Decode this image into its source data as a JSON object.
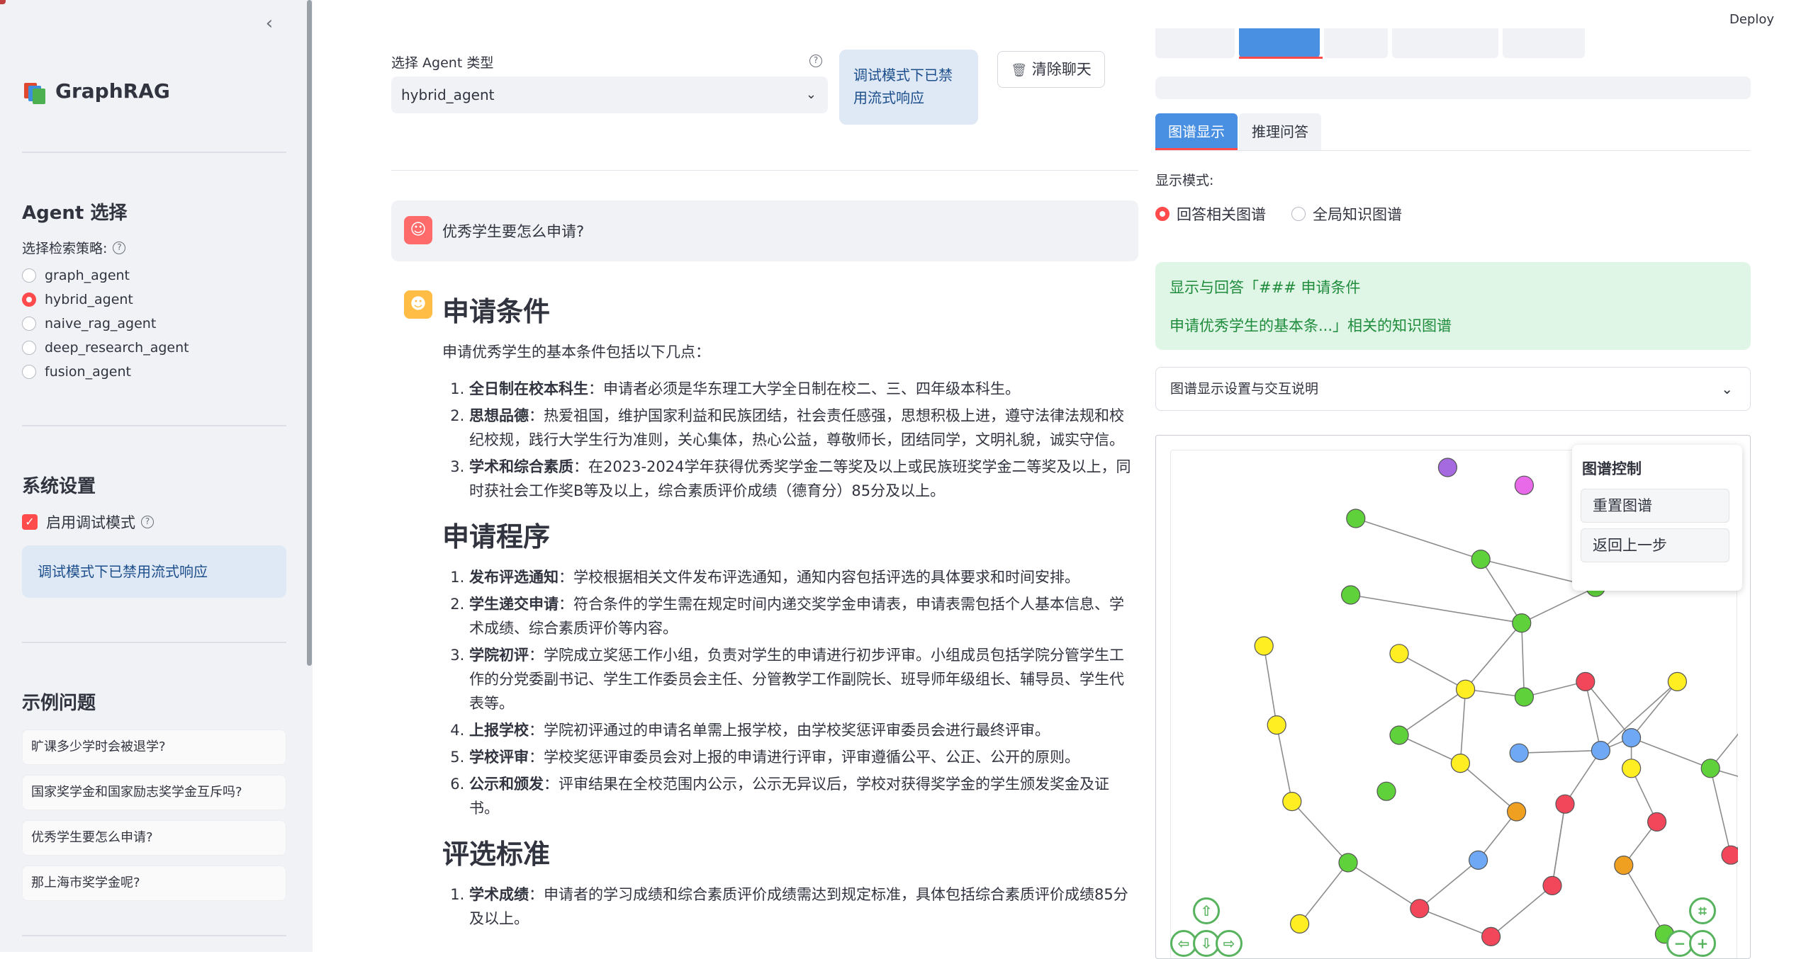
{
  "app": {
    "brand": "GraphRAG",
    "deploy": "Deploy"
  },
  "sidebar": {
    "collapse_icon": "chevron-left-icon",
    "agent_section_title": "Agent 选择",
    "strategy_label": "选择检索策略:",
    "agents": [
      "graph_agent",
      "hybrid_agent",
      "naive_rag_agent",
      "deep_research_agent",
      "fusion_agent"
    ],
    "selected_agent": "hybrid_agent",
    "system_title": "系统设置",
    "debug_label": "启用调试模式",
    "debug_checked": true,
    "debug_info": "调试模式下已禁用流式响应",
    "examples_title": "示例问题",
    "examples": [
      "旷课多少学时会被退学?",
      "国家奖学金和国家励志奖学金互斥吗?",
      "优秀学生要怎么申请?",
      "那上海市奖学金呢?"
    ]
  },
  "main": {
    "select_label": "选择 Agent 类型",
    "select_value": "hybrid_agent",
    "debug_notice": "调试模式下已禁用流式响应",
    "clear_button": "清除聊天",
    "user_message": "优秀学生要怎么申请?",
    "answer": {
      "h1": "申请条件",
      "intro": "申请优秀学生的基本条件包括以下几点：",
      "conditions": [
        {
          "b": "全日制在校本科生",
          "t": "：申请者必须是华东理工大学全日制在校二、三、四年级本科生。"
        },
        {
          "b": "思想品德",
          "t": "：热爱祖国，维护国家利益和民族团结，社会责任感强，思想积极上进，遵守法律法规和校纪校规，践行大学生行为准则，关心集体，热心公益，尊敬师长，团结同学，文明礼貌，诚实守信。"
        },
        {
          "b": "学术和综合素质",
          "t": "：在2023-2024学年获得优秀奖学金二等奖及以上或民族班奖学金二等奖及以上，同时获社会工作奖B等及以上，综合素质评价成绩（德育分）85分及以上。"
        }
      ],
      "h2": "申请程序",
      "procedures": [
        {
          "b": "发布评选通知",
          "t": "：学校根据相关文件发布评选通知，通知内容包括评选的具体要求和时间安排。"
        },
        {
          "b": "学生递交申请",
          "t": "：符合条件的学生需在规定时间内递交奖学金申请表，申请表需包括个人基本信息、学术成绩、综合素质评价等内容。"
        },
        {
          "b": "学院初评",
          "t": "：学院成立奖惩工作小组，负责对学生的申请进行初步评审。小组成员包括学院分管学生工作的分党委副书记、学生工作委员会主任、分管教学工作副院长、班导师年级组长、辅导员、学生代表等。"
        },
        {
          "b": "上报学校",
          "t": "：学院初评通过的申请名单需上报学校，由学校奖惩评审委员会进行最终评审。"
        },
        {
          "b": "学校评审",
          "t": "：学校奖惩评审委员会对上报的申请进行评审，评审遵循公平、公正、公开的原则。"
        },
        {
          "b": "公示和颁发",
          "t": "：评审结果在全校范围内公示，公示无异议后，学校对获得奖学金的学生颁发奖金及证书。"
        }
      ],
      "h3": "评选标准",
      "criteria": [
        {
          "b": "学术成绩",
          "t": "：申请者的学习成绩和综合素质评价成绩需达到规定标准，具体包括综合素质评价成绩85分及以上。"
        }
      ]
    }
  },
  "panel": {
    "sub_tabs": [
      "图谱显示",
      "推理问答"
    ],
    "mode_label": "显示模式:",
    "modes": [
      "回答相关图谱",
      "全局知识图谱"
    ],
    "selected_mode": "回答相关图谱",
    "success_line1": "显示与回答「### 申请条件",
    "success_line2": "申请优秀学生的基本条...」相关的知识图谱",
    "expander_label": "图谱显示设置与交互说明",
    "control_title": "图谱控制",
    "reset_button": "重置图谱",
    "back_button": "返回上一步",
    "node_colors": {
      "green": "#5fd13a",
      "yellow": "#ffee22",
      "red": "#f2465b",
      "blue": "#6fa8f5",
      "orange": "#f0a020",
      "purple": "#a569e0",
      "magenta": "#e86ae8"
    }
  }
}
